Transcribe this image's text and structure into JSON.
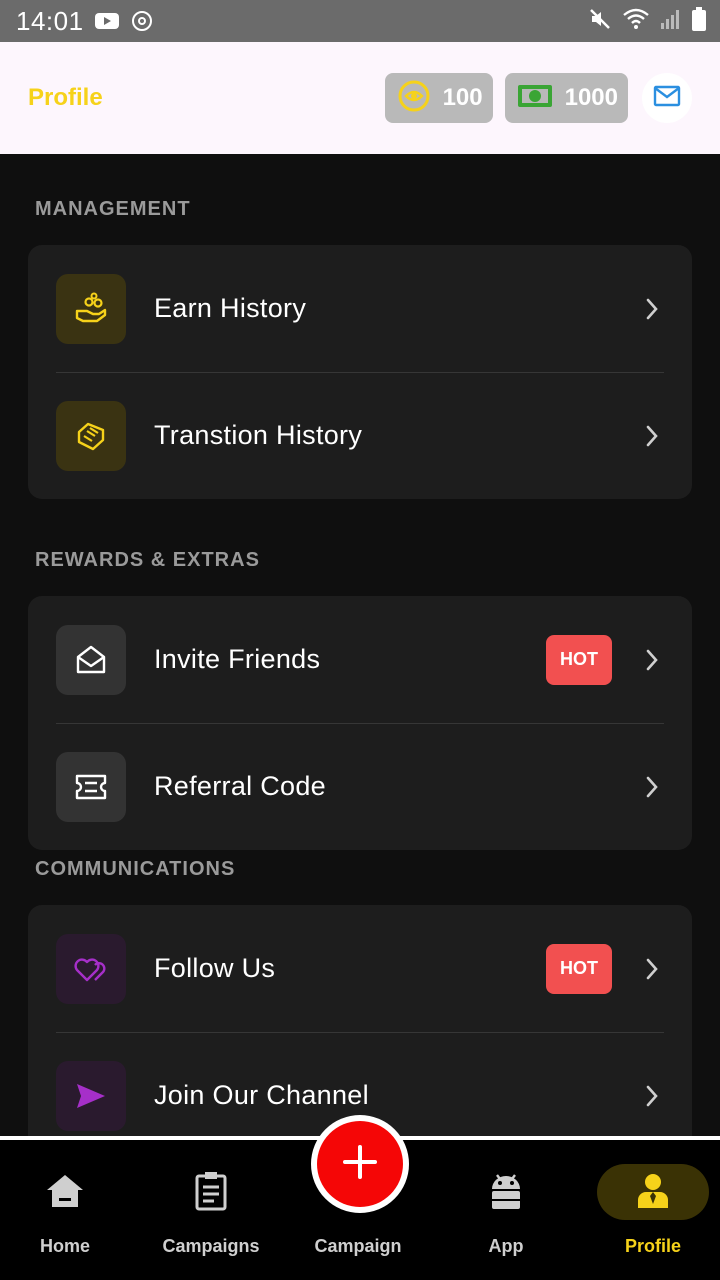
{
  "status_bar": {
    "time": "14:01"
  },
  "header": {
    "title": "Profile",
    "coins": "100",
    "cash": "1000"
  },
  "sections": {
    "management": {
      "title": "MANAGEMENT",
      "items": [
        {
          "label": "Earn History",
          "icon": "hand-coins-icon"
        },
        {
          "label": "Transtion History",
          "icon": "handshake-icon"
        }
      ]
    },
    "rewards": {
      "title": "REWARDS & EXTRAS",
      "items": [
        {
          "label": "Invite Friends",
          "icon": "envelope-open-icon",
          "badge": "HOT"
        },
        {
          "label": "Referral Code",
          "icon": "ticket-icon"
        }
      ]
    },
    "communications": {
      "title": "COMMUNICATIONS",
      "items": [
        {
          "label": "Follow Us",
          "icon": "hearts-icon",
          "badge": "HOT"
        },
        {
          "label": "Join Our Channel",
          "icon": "send-icon"
        }
      ]
    }
  },
  "bottom_nav": {
    "items": [
      {
        "label": "Home",
        "icon": "home-icon"
      },
      {
        "label": "Campaigns",
        "icon": "clipboard-icon"
      },
      {
        "label": "Campaign",
        "icon": "plus-icon"
      },
      {
        "label": "App",
        "icon": "android-icon"
      },
      {
        "label": "Profile",
        "icon": "person-icon",
        "active": true
      }
    ]
  },
  "colors": {
    "accent": "#f6d21a",
    "hot_badge": "#f25050",
    "fab": "#f50606",
    "card": "#1d1d1d",
    "background": "#0f0f0f"
  }
}
